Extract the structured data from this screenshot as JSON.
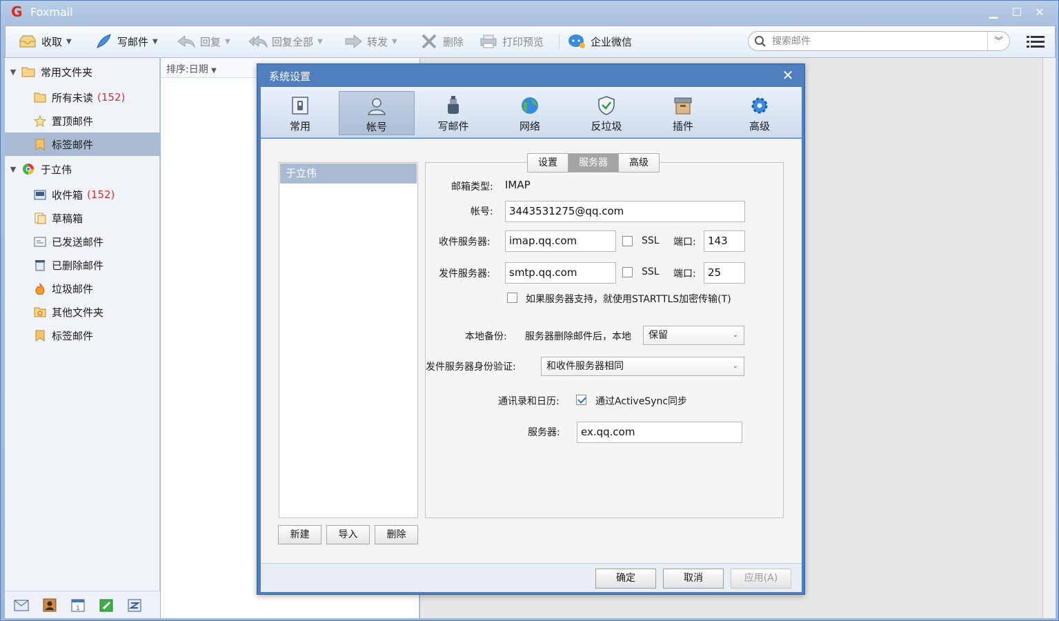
{
  "app": {
    "title": "Foxmail"
  },
  "toolbar": {
    "receive": "收取",
    "compose": "写邮件",
    "reply": "回复",
    "reply_all": "回复全部",
    "forward": "转发",
    "delete": "删除",
    "print_preview": "打印预览",
    "wecom": "企业微信"
  },
  "search": {
    "placeholder": "搜索邮件"
  },
  "sidebar": {
    "group_common": "常用文件夹",
    "common_items": [
      {
        "label": "所有未读",
        "count": "(152)"
      },
      {
        "label": "置顶邮件"
      },
      {
        "label": "标签邮件"
      }
    ],
    "account_name": "于立伟",
    "account_items": [
      {
        "label": "收件箱",
        "count": "(152)"
      },
      {
        "label": "草稿箱"
      },
      {
        "label": "已发送邮件"
      },
      {
        "label": "已删除邮件"
      },
      {
        "label": "垃圾邮件"
      },
      {
        "label": "其他文件夹"
      },
      {
        "label": "标签邮件"
      }
    ]
  },
  "list": {
    "sort_label": "排序:日期"
  },
  "dialog": {
    "title": "系统设置",
    "tabs": [
      "常用",
      "帐号",
      "写邮件",
      "网络",
      "反垃圾",
      "插件",
      "高级"
    ],
    "account_list": [
      "于立伟"
    ],
    "buttons": {
      "new": "新建",
      "import": "导入",
      "delete": "删除"
    },
    "subtabs": [
      "设置",
      "服务器",
      "高级"
    ],
    "fields": {
      "mailbox_type_label": "邮箱类型:",
      "mailbox_type_value": "IMAP",
      "account_label": "帐号:",
      "account_value": "3443531275@qq.com",
      "incoming_label": "收件服务器:",
      "incoming_value": "imap.qq.com",
      "incoming_ssl": "SSL",
      "incoming_port_label": "端口:",
      "incoming_port": "143",
      "outgoing_label": "发件服务器:",
      "outgoing_value": "smtp.qq.com",
      "outgoing_ssl": "SSL",
      "outgoing_port_label": "端口:",
      "outgoing_port": "25",
      "starttls": "如果服务器支持，就使用STARTTLS加密传输(T)",
      "backup_label": "本地备份:",
      "backup_desc": "服务器删除邮件后，本地",
      "backup_value": "保留",
      "auth_label": "发件服务器身份验证:",
      "auth_value": "和收件服务器相同",
      "contacts_label": "通讯录和日历:",
      "activesync": "通过ActiveSync同步",
      "server_label": "服务器:",
      "server_value": "ex.qq.com"
    },
    "footer": {
      "ok": "确定",
      "cancel": "取消",
      "apply": "应用(A)"
    }
  }
}
